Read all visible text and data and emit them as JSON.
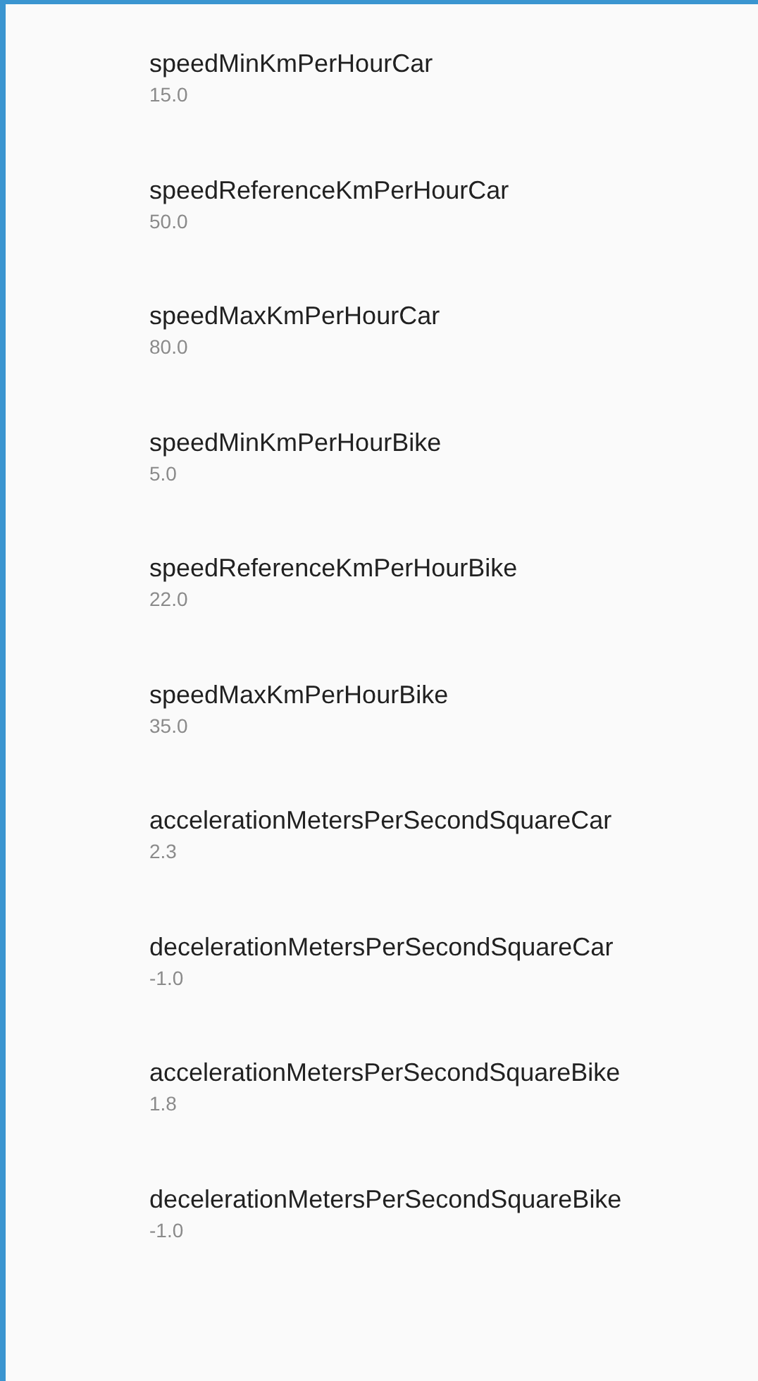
{
  "preferences": [
    {
      "title": "speedMinKmPerHourCar",
      "summary": "15.0"
    },
    {
      "title": "speedReferenceKmPerHourCar",
      "summary": "50.0"
    },
    {
      "title": "speedMaxKmPerHourCar",
      "summary": "80.0"
    },
    {
      "title": "speedMinKmPerHourBike",
      "summary": "5.0"
    },
    {
      "title": "speedReferenceKmPerHourBike",
      "summary": "22.0"
    },
    {
      "title": "speedMaxKmPerHourBike",
      "summary": "35.0"
    },
    {
      "title": "accelerationMetersPerSecondSquareCar",
      "summary": "2.3"
    },
    {
      "title": "decelerationMetersPerSecondSquareCar",
      "summary": "-1.0"
    },
    {
      "title": "accelerationMetersPerSecondSquareBike",
      "summary": "1.8"
    },
    {
      "title": "decelerationMetersPerSecondSquareBike",
      "summary": "-1.0"
    }
  ]
}
